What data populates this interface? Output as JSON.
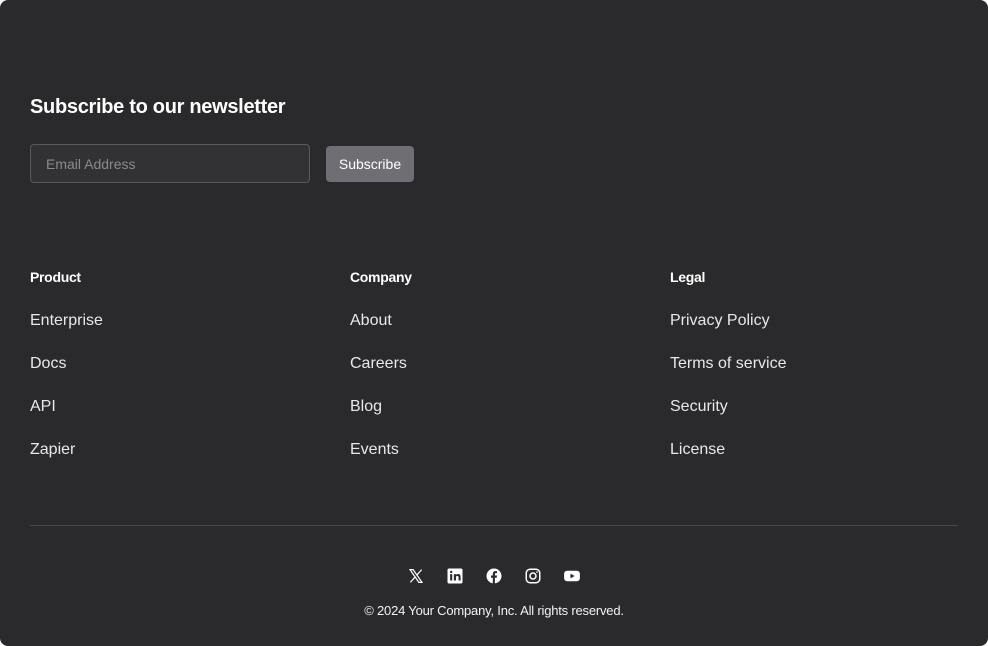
{
  "newsletter": {
    "title": "Subscribe to our newsletter",
    "email_placeholder": "Email Address",
    "email_value": "",
    "subscribe_label": "Subscribe"
  },
  "columns": [
    {
      "heading": "Product",
      "links": [
        "Enterprise",
        "Docs",
        "API",
        "Zapier"
      ]
    },
    {
      "heading": "Company",
      "links": [
        "About",
        "Careers",
        "Blog",
        "Events"
      ]
    },
    {
      "heading": "Legal",
      "links": [
        "Privacy Policy",
        "Terms of service",
        "Security",
        "License"
      ]
    }
  ],
  "social": {
    "icons": [
      "x-icon",
      "linkedin-icon",
      "facebook-icon",
      "instagram-icon",
      "youtube-icon"
    ]
  },
  "copyright": "© 2024 Your Company, Inc. All rights reserved.",
  "colors": {
    "background": "#2a2a2c",
    "subscribe_button": "#6e6e74",
    "text": "#ffffff"
  }
}
